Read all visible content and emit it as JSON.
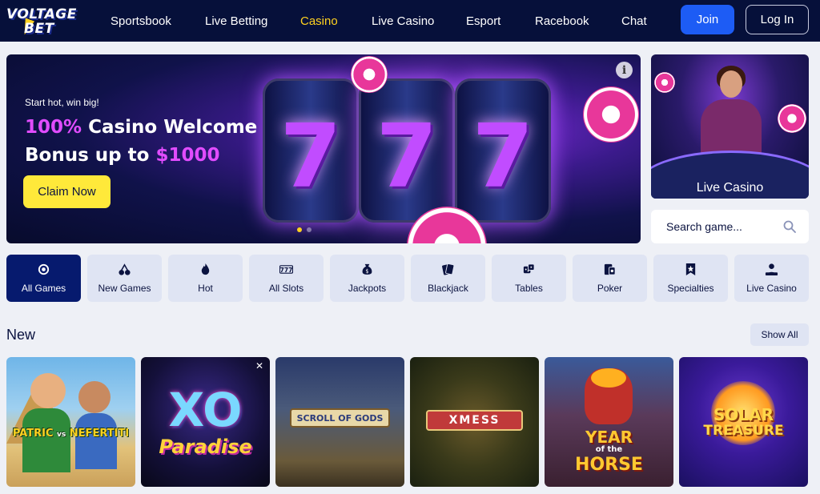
{
  "brand": {
    "line1": "VOLTAGE",
    "line2": "BET"
  },
  "nav": {
    "items": [
      "Sportsbook",
      "Live Betting",
      "Casino",
      "Live Casino",
      "Esport",
      "Racebook",
      "Chat"
    ],
    "active": "Casino",
    "join_label": "Join",
    "login_label": "Log In"
  },
  "hero": {
    "subtitle": "Start hot, win big!",
    "title_pct": "100%",
    "title_mid": " Casino Welcome",
    "title_line2": "Bonus up to ",
    "title_amount": "$1000",
    "cta_label": "Claim Now",
    "info_symbol": "i"
  },
  "live_card": {
    "label": "Live Casino"
  },
  "search": {
    "placeholder": "Search game..."
  },
  "categories": [
    {
      "label": "All Games",
      "icon": "all-games-icon",
      "active": true
    },
    {
      "label": "New Games",
      "icon": "cherries-icon"
    },
    {
      "label": "Hot",
      "icon": "flame-icon"
    },
    {
      "label": "All Slots",
      "icon": "slots-777-icon"
    },
    {
      "label": "Jackpots",
      "icon": "money-bag-icon"
    },
    {
      "label": "Blackjack",
      "icon": "cards-icon"
    },
    {
      "label": "Tables",
      "icon": "dice-icon"
    },
    {
      "label": "Poker",
      "icon": "poker-cards-icon"
    },
    {
      "label": "Specialties",
      "icon": "bookmark-star-icon"
    },
    {
      "label": "Live Casino",
      "icon": "dealer-icon"
    }
  ],
  "new_section": {
    "title": "New",
    "show_all_label": "Show All",
    "games": [
      {
        "title_a": "PATRIC",
        "title_vs": "vs",
        "title_b": "NEFERTITI"
      },
      {
        "title_a": "XO",
        "title_b": "Paradise"
      },
      {
        "title_a": "SCROLL OF GODS"
      },
      {
        "title_a": "XMESS"
      },
      {
        "title_a": "YEAR",
        "title_b": "of the",
        "title_c": "HORSE"
      },
      {
        "title_a": "SOLAR",
        "title_b": "TREASURE"
      }
    ]
  },
  "colors": {
    "header_bg": "#06103a",
    "accent_blue": "#1d5cf5",
    "accent_yellow": "#ffe93a",
    "active_cat": "#061a6e",
    "pink": "#e14cff"
  }
}
